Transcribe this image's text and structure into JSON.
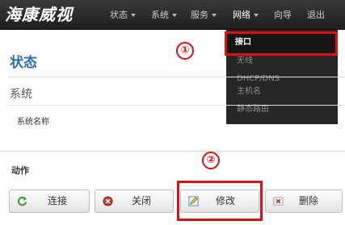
{
  "brand": {
    "logo_text": "海康威视"
  },
  "nav": {
    "items": [
      {
        "label": "状态",
        "caret": true
      },
      {
        "label": "系统",
        "caret": true
      },
      {
        "label": "服务",
        "caret": true
      },
      {
        "label": "网络",
        "caret": true
      },
      {
        "label": "向导",
        "caret": false
      },
      {
        "label": "退出",
        "caret": false
      }
    ]
  },
  "dropdown": {
    "items": [
      "接口",
      "无线",
      "DHCP/DNS",
      "主机名",
      "静态路由"
    ],
    "active_index": 0
  },
  "annotations": {
    "step1": "①",
    "step2": "②"
  },
  "page": {
    "title": "状态",
    "section": "系统",
    "field_label": "系统名称"
  },
  "actions": {
    "title": "动作",
    "buttons": [
      {
        "label": "连接",
        "icon": "refresh-icon"
      },
      {
        "label": "关闭",
        "icon": "stop-icon"
      },
      {
        "label": "修改",
        "icon": "edit-icon"
      },
      {
        "label": "删除",
        "icon": "delete-icon"
      }
    ]
  },
  "colors": {
    "accent": "#2c6fb1",
    "highlight": "#e01010",
    "navbar": "#262626"
  }
}
